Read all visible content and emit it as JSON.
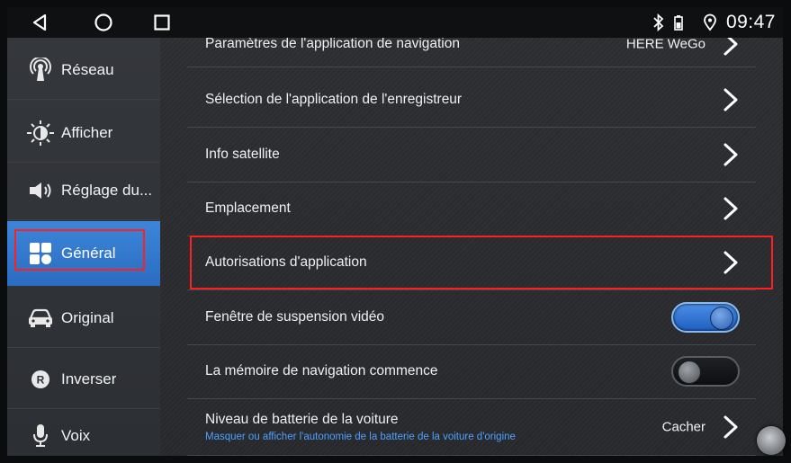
{
  "statusbar": {
    "time": "09:47",
    "icons": [
      "back-triangle-icon",
      "home-circle-icon",
      "recent-square-icon",
      "bluetooth-icon",
      "battery-icon",
      "location-pin-icon"
    ]
  },
  "sidebar": {
    "items": [
      {
        "label": "Réseau",
        "icon": "antenna-icon"
      },
      {
        "label": "Afficher",
        "icon": "brightness-icon"
      },
      {
        "label": "Réglage du...",
        "icon": "speaker-icon"
      },
      {
        "label": "Général",
        "icon": "grid-icon",
        "active": true
      },
      {
        "label": "Original",
        "icon": "car-icon"
      },
      {
        "label": "Inverser",
        "icon": "reverse-r-icon"
      },
      {
        "label": "Voix",
        "icon": "microphone-icon"
      }
    ]
  },
  "settings": {
    "nav_app": {
      "label": "Paramètres de l'application de navigation",
      "value": "HERE WeGo"
    },
    "recorder_app": {
      "label": "Sélection de l'application de l'enregistreur"
    },
    "satellite": {
      "label": "Info satellite"
    },
    "location": {
      "label": "Emplacement"
    },
    "permissions": {
      "label": "Autorisations d'application"
    },
    "video_float": {
      "label": "Fenêtre de suspension vidéo",
      "enabled": true
    },
    "nav_memory": {
      "label": "La mémoire de navigation commence",
      "enabled": false
    },
    "battery_level": {
      "label": "Niveau de batterie de la voiture",
      "subtitle": "Masquer ou afficher l'autonomie de la batterie de la voiture d'origine",
      "value": "Cacher"
    }
  },
  "colors": {
    "accent": "#2f74cc",
    "highlight_box": "#ff1f1f",
    "subtitle": "#4ea0ff"
  }
}
